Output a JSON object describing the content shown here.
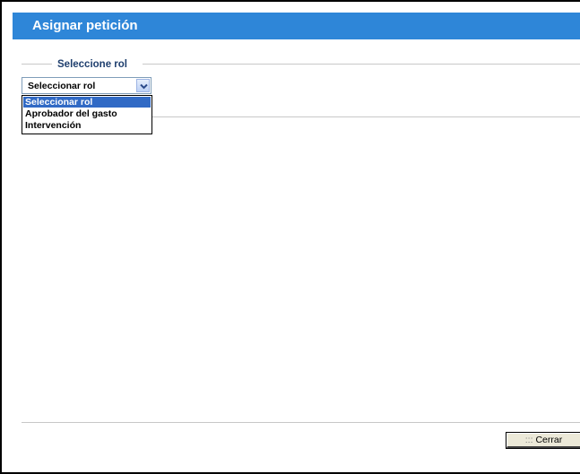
{
  "window": {
    "title": "Asignar petición"
  },
  "fieldset": {
    "legend": "Seleccione rol"
  },
  "role_select": {
    "selected": "Seleccionar rol",
    "options": [
      {
        "label": "Seleccionar rol",
        "selected": true
      },
      {
        "label": "Aprobador del gasto",
        "selected": false
      },
      {
        "label": "Intervención",
        "selected": false
      }
    ]
  },
  "footer": {
    "close_prefix": ":::",
    "close_label": "Cerrar"
  },
  "colors": {
    "title_bar": "#2e86d8",
    "selected_option": "#316ac5",
    "legend_text": "#1f3f6e"
  }
}
